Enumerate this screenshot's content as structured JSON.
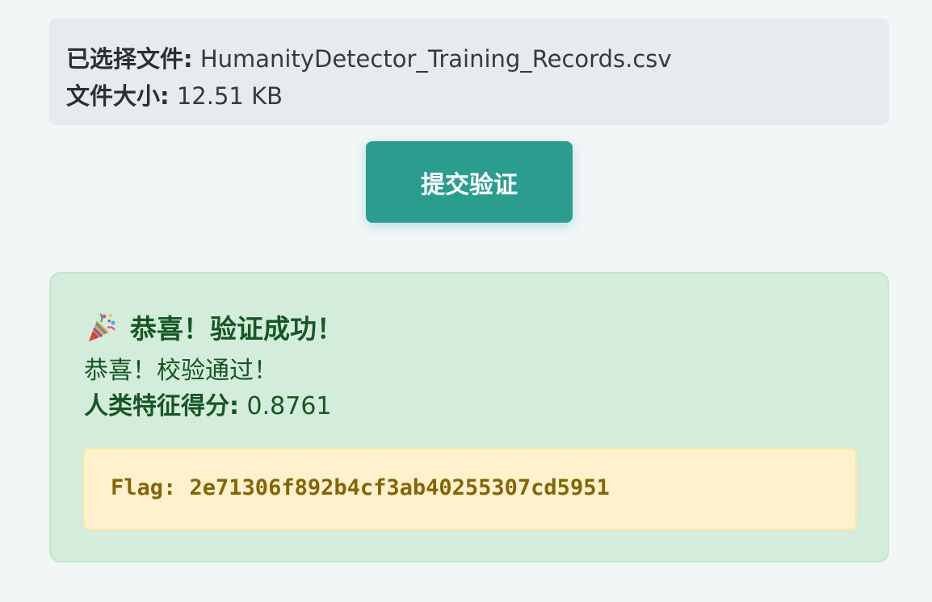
{
  "file_info": {
    "selected_label": "已选择文件:",
    "selected_value": "HumanityDetector_Training_Records.csv",
    "size_label": "文件大小:",
    "size_value": "12.51 KB"
  },
  "submit_button": {
    "label": "提交验证"
  },
  "result": {
    "icon": "party-popper-icon",
    "title": "恭喜！验证成功！",
    "message": "恭喜！校验通过！",
    "score_label": "人类特征得分:",
    "score_value": "0.8761",
    "flag": "Flag: 2e71306f892b4cf3ab40255307cd5951"
  },
  "colors": {
    "accent_button": "#2a9d8f",
    "success_bg": "#d4ecdb",
    "success_text": "#155724",
    "flag_bg": "#fff1cd",
    "flag_text": "#856404"
  }
}
